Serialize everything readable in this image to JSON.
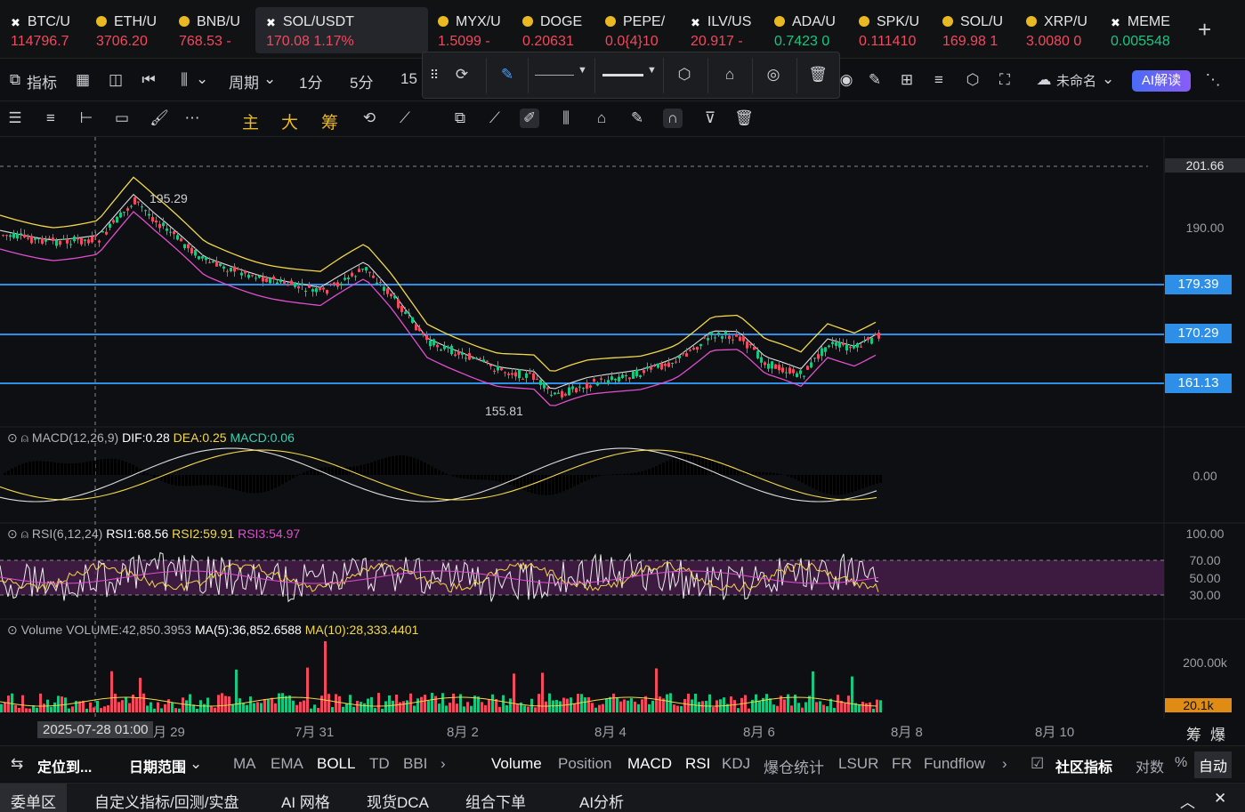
{
  "ticker": [
    {
      "sym": "BTC/U",
      "price": "114796.7",
      "color": "red",
      "icon": "x-icon"
    },
    {
      "sym": "ETH/U",
      "price": "3706.20",
      "color": "red",
      "icon": "coin-icon"
    },
    {
      "sym": "BNB/U",
      "price": "768.53 -",
      "color": "red",
      "icon": "coin-icon"
    },
    {
      "sym": "SOL/USDT",
      "price": "170.08  1.17%",
      "color": "red",
      "icon": "x-icon"
    },
    {
      "sym": "MYX/U",
      "price": "1.5099 -",
      "color": "red",
      "icon": "coin-icon"
    },
    {
      "sym": "DOGE",
      "price": "0.20631",
      "color": "red",
      "icon": "coin-icon"
    },
    {
      "sym": "PEPE/",
      "price": "0.0{4}10",
      "color": "red",
      "icon": "coin-icon"
    },
    {
      "sym": "ILV/US",
      "price": "20.917 -",
      "color": "red",
      "icon": "x-icon"
    },
    {
      "sym": "ADA/U",
      "price": "0.7423 0",
      "color": "green",
      "icon": "coin-icon"
    },
    {
      "sym": "SPK/U",
      "price": "0.111410",
      "color": "red",
      "icon": "coin-icon"
    },
    {
      "sym": "SOL/U",
      "price": "169.98 1",
      "color": "red",
      "icon": "coin-icon"
    },
    {
      "sym": "XRP/U",
      "price": "3.0080 0",
      "color": "red",
      "icon": "coin-icon"
    },
    {
      "sym": "MEME",
      "price": "0.005548",
      "color": "green",
      "icon": "x-icon"
    }
  ],
  "toolbar": {
    "indicator": "指标",
    "period": "周期",
    "tf1": "1分",
    "tf5": "5分",
    "tf15": "15",
    "account": "未命名",
    "ai": "AI解读"
  },
  "drawbar": {
    "zhu": "主",
    "da": "大",
    "chou": "筹"
  },
  "price_axis": {
    "top_label": "201.66",
    "ticks": [
      "190.00"
    ],
    "levels": [
      "179.39",
      "170.29",
      "161.13"
    ],
    "annot_high": "195.29",
    "annot_low": "155.81"
  },
  "macd": {
    "name": "MACD(12,26,9)",
    "dif": "DIF:0.28",
    "dea": "DEA:0.25",
    "macd": "MACD:0.06",
    "zero": "0.00"
  },
  "rsi": {
    "name": "RSI(6,12,24)",
    "r1": "RSI1:68.56",
    "r2": "RSI2:59.91",
    "r3": "RSI3:54.97",
    "t100": "100.00",
    "t70": "70.00",
    "t50": "50.00",
    "t30": "30.00"
  },
  "volume": {
    "name": "Volume",
    "vol": "VOLUME:42,850.3953",
    "ma5": "MA(5):36,852.6588",
    "ma10": "MA(10):28,333.4401",
    "tick": "200.00k",
    "current": "20.1k"
  },
  "xaxis": {
    "cursor": "2025-07-28 01:00",
    "labels": [
      "月 29",
      "7月 31",
      "8月 2",
      "8月 4",
      "8月 6",
      "8月 8",
      "8月 10"
    ],
    "right1": "筹",
    "right2": "爆"
  },
  "bottom_tabs": {
    "locate": "定位到...",
    "range": "日期范围",
    "main": [
      "MA",
      "EMA",
      "BOLL",
      "TD",
      "BBI"
    ],
    "sub": [
      "Volume",
      "Position",
      "MACD",
      "RSI",
      "KDJ",
      "爆仓统计",
      "LSUR",
      "FR",
      "Fundflow"
    ],
    "community": "社区指标",
    "log": "对数",
    "pct": "%",
    "auto": "自动"
  },
  "footer": [
    "委单区",
    "自定义指标/回测/实盘",
    "AI 网格",
    "现货DCA",
    "组合下单",
    "AI分析"
  ],
  "colors": {
    "up": "#16c784",
    "down": "#f2495e",
    "level": "#2e8fe8",
    "yellow": "#f3d84a",
    "pink": "#e04fd0"
  }
}
